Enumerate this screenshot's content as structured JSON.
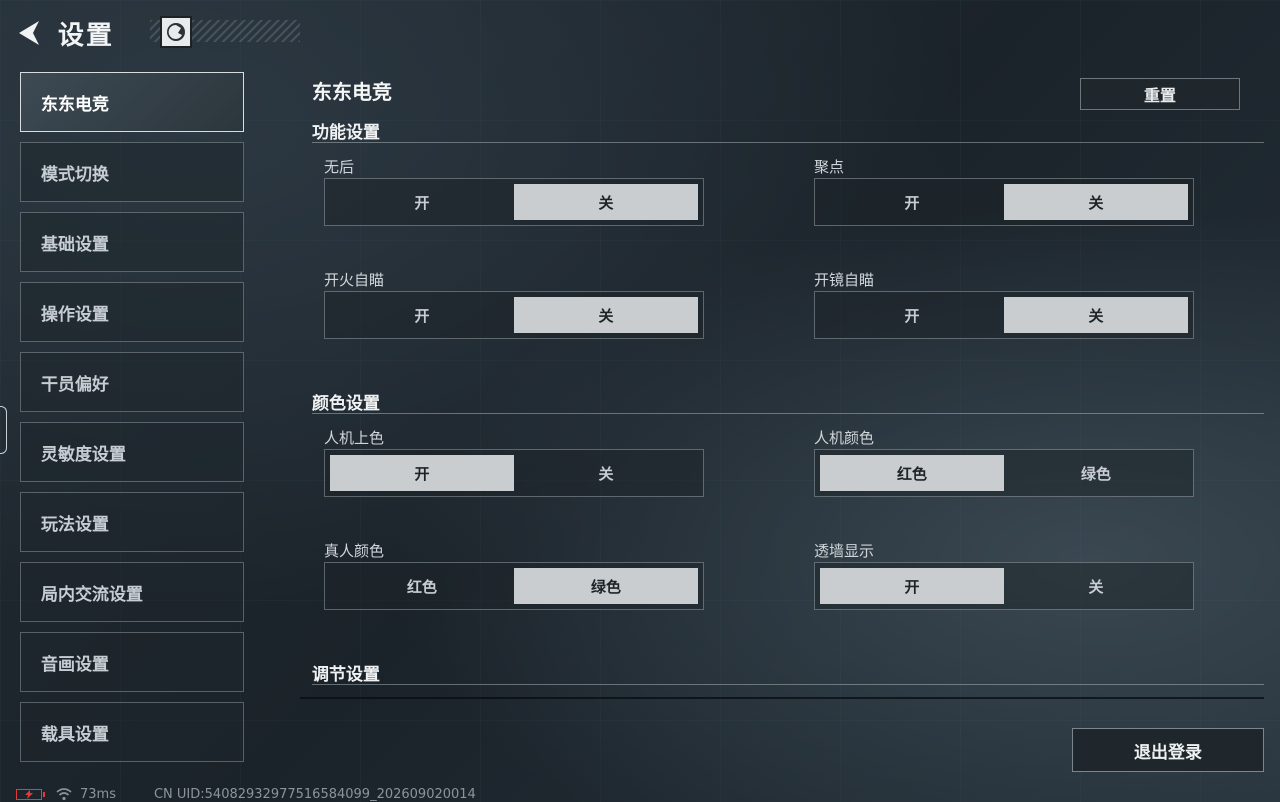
{
  "header": {
    "title": "设置"
  },
  "sidebar": {
    "items": [
      {
        "label": "东东电竞",
        "active": true
      },
      {
        "label": "模式切换"
      },
      {
        "label": "基础设置"
      },
      {
        "label": "操作设置"
      },
      {
        "label": "干员偏好"
      },
      {
        "label": "灵敏度设置"
      },
      {
        "label": "玩法设置"
      },
      {
        "label": "局内交流设置"
      },
      {
        "label": "音画设置"
      },
      {
        "label": "载具设置"
      }
    ]
  },
  "main": {
    "title": "东东电竞",
    "reset_label": "重置",
    "sections": [
      {
        "heading": "功能设置",
        "settings": [
          {
            "label": "无后",
            "options": [
              "开",
              "关"
            ],
            "selected": 1
          },
          {
            "label": "聚点",
            "options": [
              "开",
              "关"
            ],
            "selected": 1
          },
          {
            "label": "开火自瞄",
            "options": [
              "开",
              "关"
            ],
            "selected": 1
          },
          {
            "label": "开镜自瞄",
            "options": [
              "开",
              "关"
            ],
            "selected": 1
          }
        ]
      },
      {
        "heading": "颜色设置",
        "settings": [
          {
            "label": "人机上色",
            "options": [
              "开",
              "关"
            ],
            "selected": 0
          },
          {
            "label": "人机颜色",
            "options": [
              "红色",
              "绿色"
            ],
            "selected": 0
          },
          {
            "label": "真人颜色",
            "options": [
              "红色",
              "绿色"
            ],
            "selected": 1
          },
          {
            "label": "透墙显示",
            "options": [
              "开",
              "关"
            ],
            "selected": 0
          }
        ]
      },
      {
        "heading": "调节设置",
        "settings": []
      }
    ],
    "logout_label": "退出登录"
  },
  "status": {
    "ping": "73ms",
    "uid": "CN UID:540829329775165840​99_202609020014"
  },
  "colors": {
    "selected_option_bg": "#c9cdcf",
    "active_nav_border": "#d8dde0",
    "battery_low": "#e23b3b"
  }
}
